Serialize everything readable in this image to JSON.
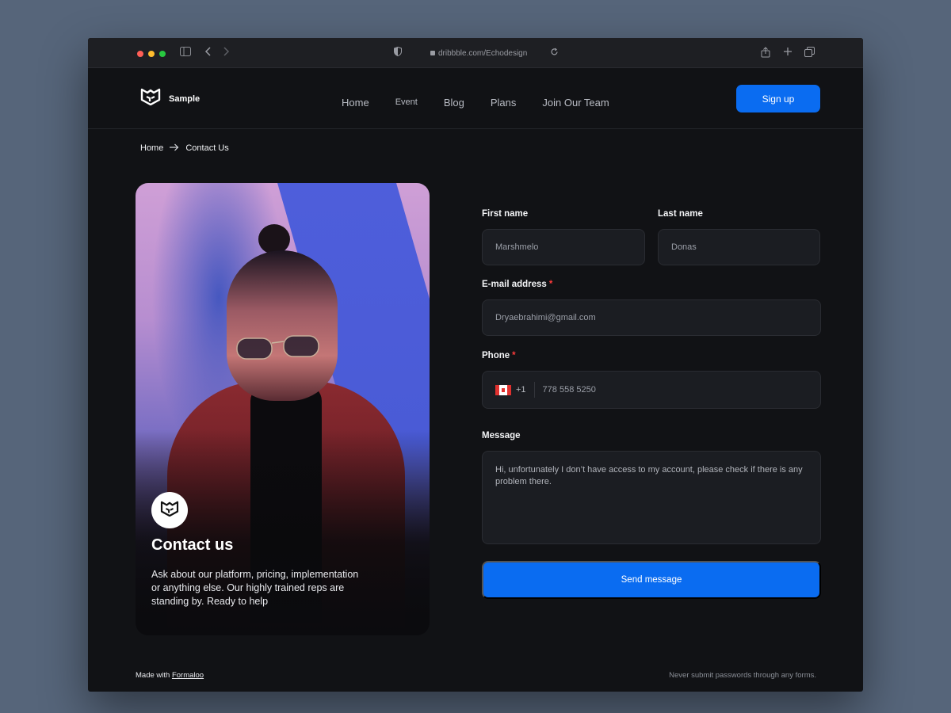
{
  "browser": {
    "url": "dribbble.com/Echodesign"
  },
  "header": {
    "logo_text": "Sample",
    "nav": [
      "Home",
      "Event",
      "Blog",
      "Plans",
      "Join Our Team"
    ],
    "signup_label": "Sign up"
  },
  "breadcrumb": {
    "home": "Home",
    "current": "Contact Us"
  },
  "hero": {
    "title": "Contact us",
    "description": "Ask about our platform, pricing, implementation or anything else. Our highly trained reps are standing by. Ready to help"
  },
  "form": {
    "first_name": {
      "label": "First name",
      "value": "Marshmelo"
    },
    "last_name": {
      "label": "Last name",
      "value": "Donas"
    },
    "email": {
      "label": "E-mail address",
      "required_mark": "*",
      "value": "Dryaebrahimi@gmail.com"
    },
    "phone": {
      "label": "Phone",
      "required_mark": "*",
      "country_code": "+1",
      "value": "778 558 5250"
    },
    "message": {
      "label": "Message",
      "value": "Hi, unfortunately I don’t have access to my account, please check if there is any problem there."
    },
    "submit_label": "Send message"
  },
  "footer": {
    "made_with": "Made with",
    "made_with_link": "Formaloo",
    "notice": "Never submit passwords through any forms."
  },
  "colors": {
    "accent": "#0a6cf1",
    "page_bg": "#111215",
    "required": "#ff3b3b"
  }
}
